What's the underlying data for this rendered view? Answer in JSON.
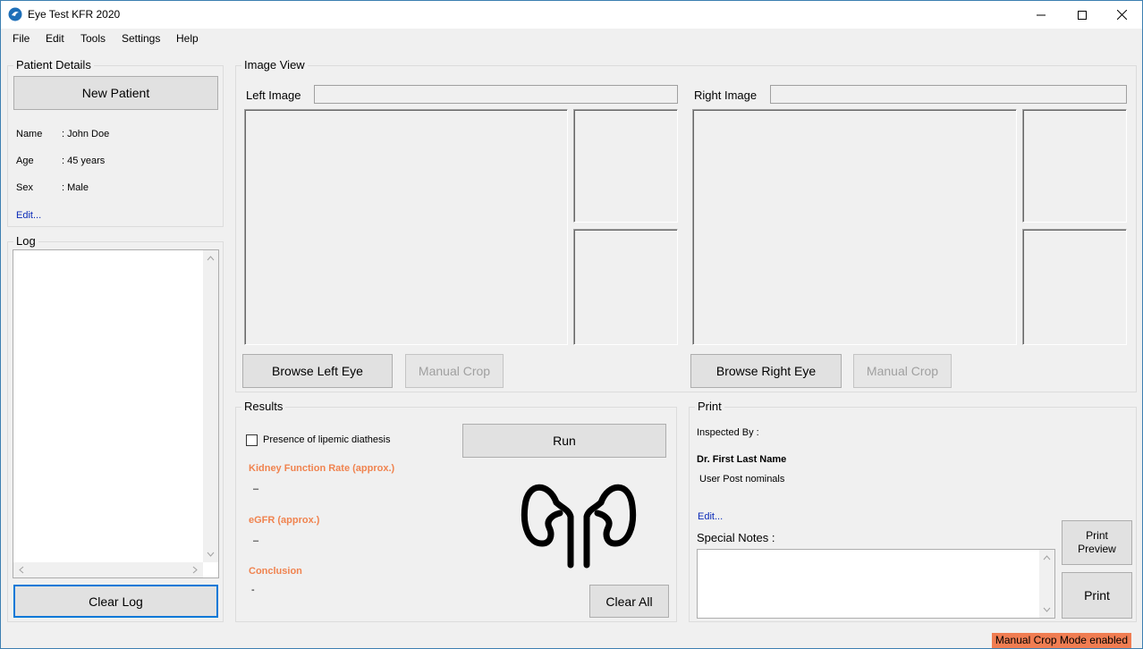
{
  "window": {
    "title": "Eye Test KFR 2020"
  },
  "menu": [
    "File",
    "Edit",
    "Tools",
    "Settings",
    "Help"
  ],
  "patient": {
    "group_title": "Patient Details",
    "new_patient_label": "New Patient",
    "name_label": "Name",
    "name_value": ": John Doe",
    "age_label": "Age",
    "age_value": ": 45 years",
    "sex_label": "Sex",
    "sex_value": ": Male",
    "edit_link": "Edit..."
  },
  "log": {
    "group_title": "Log",
    "clear_label": "Clear Log"
  },
  "image_view": {
    "group_title": "Image View",
    "left_label": "Left Image",
    "right_label": "Right Image",
    "browse_left_label": "Browse Left Eye",
    "browse_right_label": "Browse Right Eye",
    "manual_crop_label": "Manual Crop"
  },
  "results": {
    "group_title": "Results",
    "checkbox_label": "Presence of lipemic diathesis",
    "run_label": "Run",
    "kfr_title": "Kidney Function Rate (approx.)",
    "kfr_value": "–",
    "egfr_title": "eGFR (approx.)",
    "egfr_value": "–",
    "conclusion_title": "Conclusion",
    "conclusion_value": "-",
    "clear_all_label": "Clear All",
    "kidney_icon": "kidney-icon"
  },
  "print": {
    "group_title": "Print",
    "inspected_by_label": "Inspected By :",
    "doctor_name": "Dr. First Last Name",
    "post_nominals": "User Post nominals",
    "edit_link": "Edit...",
    "special_notes_label": "Special Notes :",
    "print_preview_line1": "Print",
    "print_preview_line2": "Preview",
    "print_label": "Print"
  },
  "status": {
    "badge_text": "Manual Crop Mode enabled",
    "badge_color": "#f07d52"
  }
}
